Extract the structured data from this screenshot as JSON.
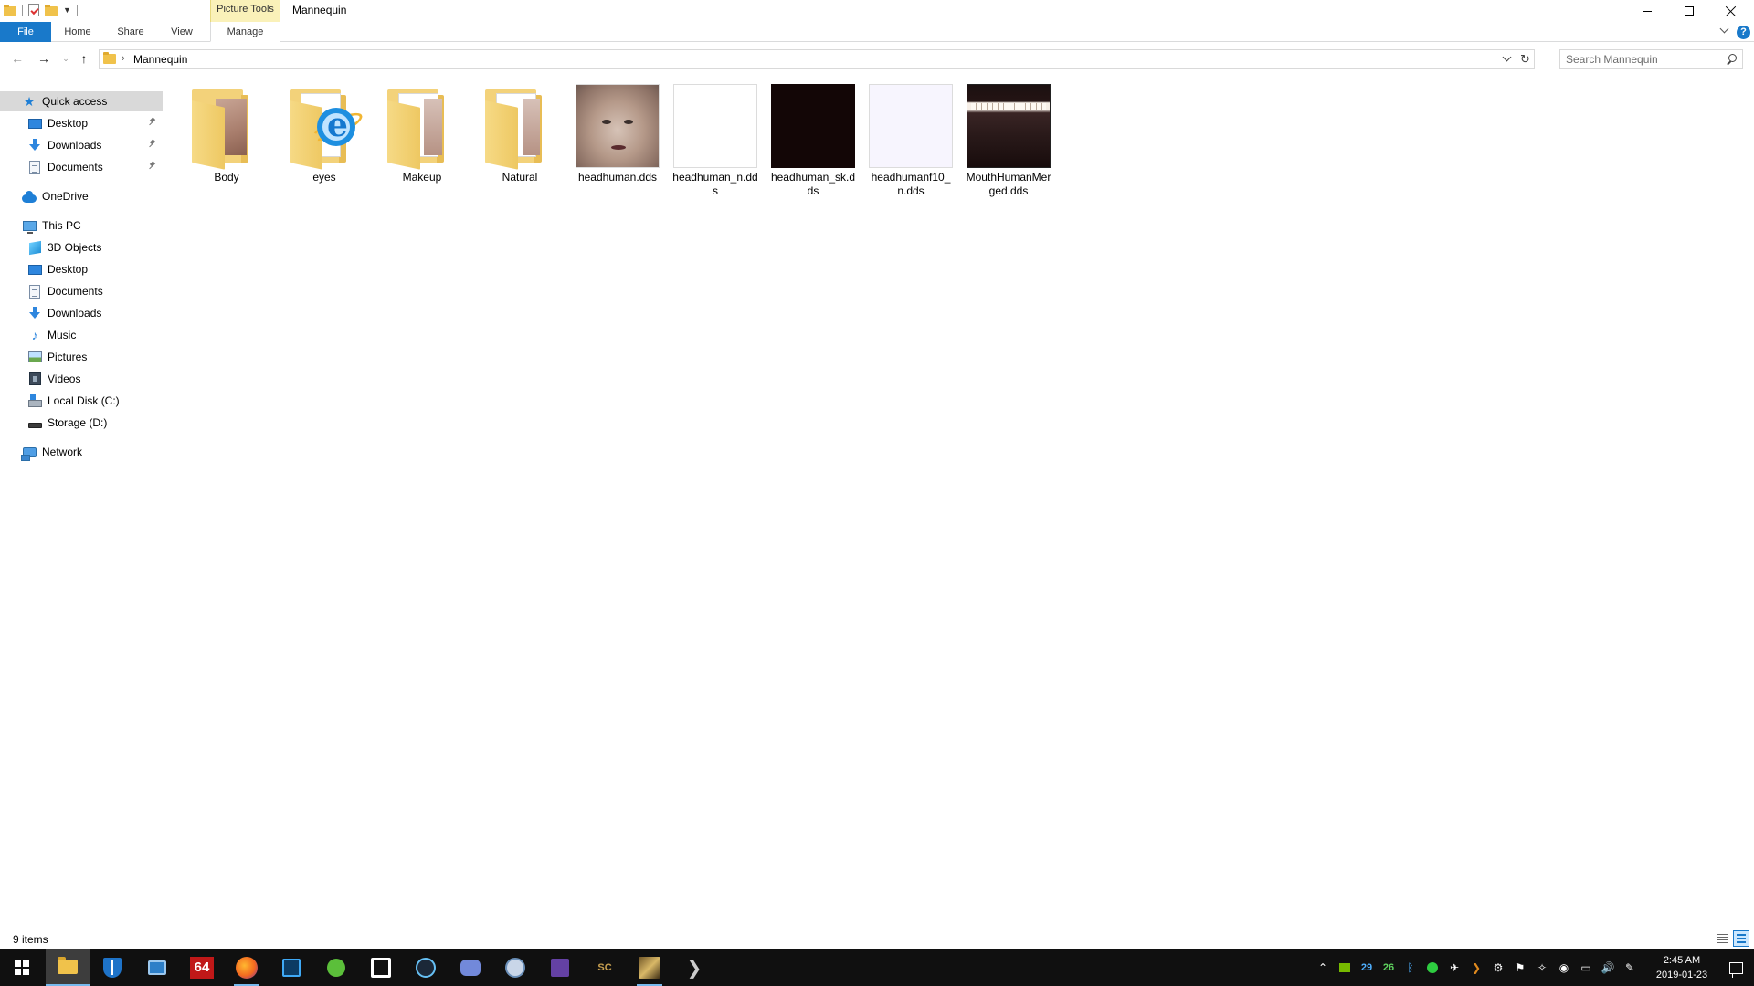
{
  "window": {
    "title": "Mannequin",
    "context_tab": "Picture Tools"
  },
  "ribbon": {
    "tabs": [
      {
        "label": "File"
      },
      {
        "label": "Home"
      },
      {
        "label": "Share"
      },
      {
        "label": "View"
      },
      {
        "label": "Manage"
      }
    ]
  },
  "address": {
    "path": "Mannequin",
    "search_placeholder": "Search Mannequin"
  },
  "nav": {
    "quick_access": "Quick access",
    "quick_items": [
      "Desktop",
      "Downloads",
      "Documents"
    ],
    "onedrive": "OneDrive",
    "this_pc": "This PC",
    "pc_items": [
      "3D Objects",
      "Desktop",
      "Documents",
      "Downloads",
      "Music",
      "Pictures",
      "Videos",
      "Local Disk (C:)",
      "Storage (D:)"
    ],
    "network": "Network"
  },
  "files": [
    {
      "name": "Body",
      "kind": "folder"
    },
    {
      "name": "eyes",
      "kind": "folder"
    },
    {
      "name": "Makeup",
      "kind": "folder"
    },
    {
      "name": "Natural",
      "kind": "folder"
    },
    {
      "name": "headhuman.dds",
      "kind": "image"
    },
    {
      "name": "headhuman_n.dds",
      "kind": "image"
    },
    {
      "name": "headhuman_sk.dds",
      "kind": "image"
    },
    {
      "name": "headhumanf10_n.dds",
      "kind": "image"
    },
    {
      "name": "MouthHumanMerged.dds",
      "kind": "image"
    }
  ],
  "status": {
    "items_count": "9 items"
  },
  "taskbar": {
    "tray_numbers": [
      "29",
      "26"
    ],
    "time": "2:45 AM",
    "date": "2019-01-23",
    "app_labels": {
      "a64": "64",
      "sc": "SC"
    }
  },
  "colors": {
    "accent": "#1979ca",
    "context_tab": "#faf1b9",
    "selection": "#d9d9d9",
    "taskbar": "#101010"
  }
}
